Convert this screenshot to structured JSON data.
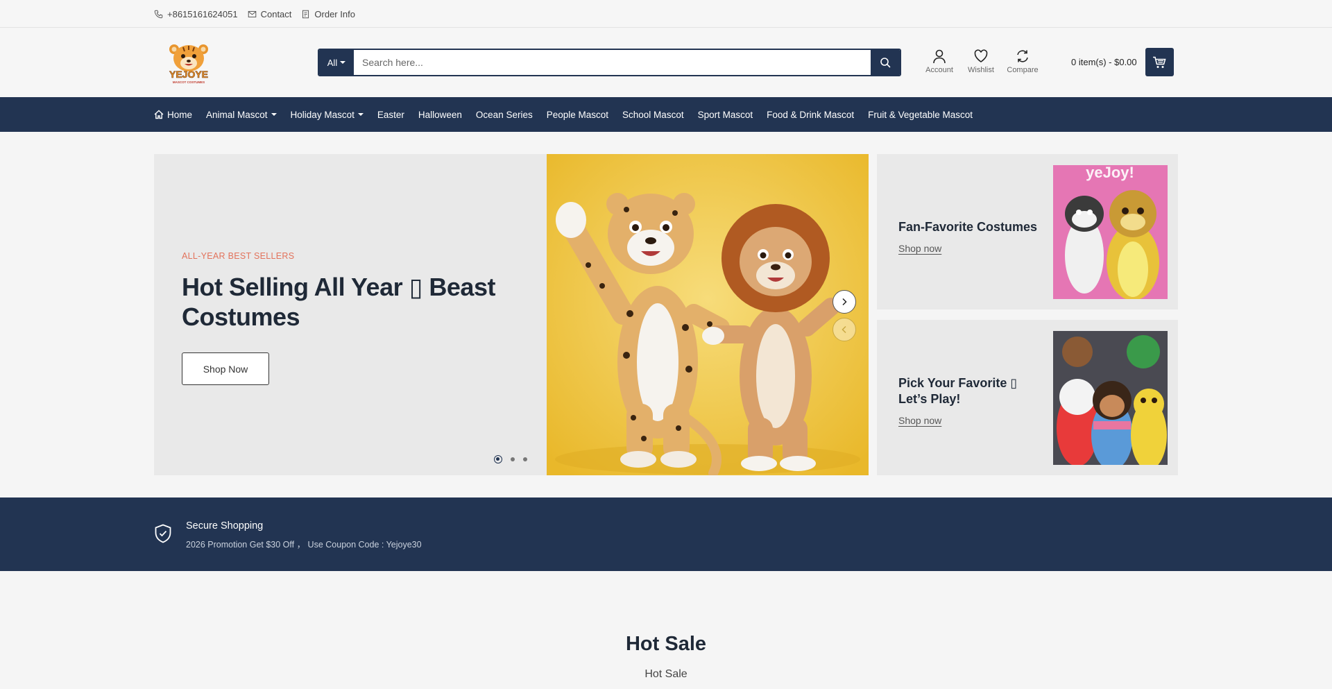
{
  "topbar": {
    "phone": "+8615161624051",
    "contact": "Contact",
    "order_info": "Order Info"
  },
  "header": {
    "logo_text": "YEJOYE",
    "logo_subtext": "MASCOT COSTUMES",
    "search_category": "All",
    "search_placeholder": "Search here...",
    "account": "Account",
    "wishlist": "Wishlist",
    "compare": "Compare",
    "cart_text": "0 item(s) - $0.00"
  },
  "nav": {
    "items": [
      {
        "label": "Home"
      },
      {
        "label": "Animal Mascot"
      },
      {
        "label": "Holiday Mascot"
      },
      {
        "label": "Easter"
      },
      {
        "label": "Halloween"
      },
      {
        "label": "Ocean Series"
      },
      {
        "label": "People Mascot"
      },
      {
        "label": "School Mascot"
      },
      {
        "label": "Sport Mascot"
      },
      {
        "label": "Food & Drink Mascot"
      },
      {
        "label": "Fruit & Vegetable Mascot"
      }
    ]
  },
  "hero": {
    "subtitle": "ALL-YEAR BEST SELLERS",
    "title": "Hot Selling All Year ▯ Beast Costumes",
    "button": "Shop Now",
    "slides": 3,
    "active_slide": 1
  },
  "banners": [
    {
      "title": "Fan-Favorite Costumes",
      "link": "Shop now"
    },
    {
      "title": "Pick Your Favorite ▯ Let’s Play!",
      "link": "Shop now"
    }
  ],
  "features": {
    "title": "Secure Shopping",
    "description": "2026 Promotion Get $30 Off ， Use Coupon Code : Yejoye30"
  },
  "section": {
    "title": "Hot Sale",
    "subtitle": "Hot Sale"
  },
  "colors": {
    "primary": "#223452",
    "accent": "#e2725b",
    "background": "#f5f5f5"
  }
}
